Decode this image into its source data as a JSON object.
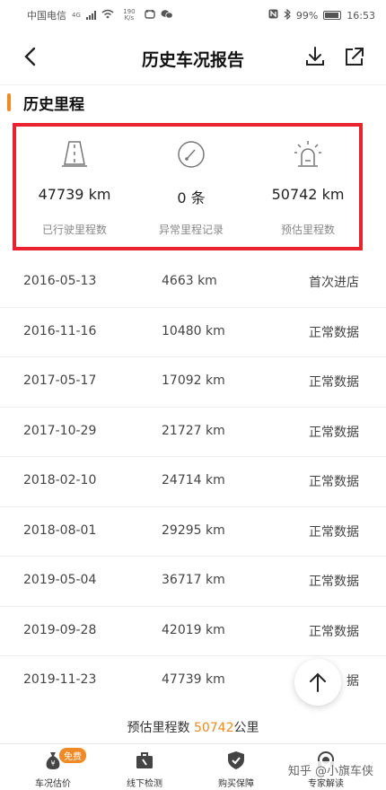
{
  "status_bar": {
    "carrier": "中国电信",
    "net": "4G",
    "speed": "190 K/s",
    "battery": "99%",
    "time": "16:53"
  },
  "header": {
    "title": "历史车况报告"
  },
  "section": {
    "title": "历史里程"
  },
  "summary": {
    "driven": {
      "value": "47739 km",
      "label": "已行驶里程数"
    },
    "abnormal": {
      "value": "0 条",
      "label": "异常里程记录"
    },
    "estimated": {
      "value": "50742 km",
      "label": "预估里程数"
    }
  },
  "records": [
    {
      "date": "2016-05-13",
      "km": "4663 km",
      "status": "首次进店"
    },
    {
      "date": "2016-11-16",
      "km": "10480 km",
      "status": "正常数据"
    },
    {
      "date": "2017-05-17",
      "km": "17092 km",
      "status": "正常数据"
    },
    {
      "date": "2017-10-29",
      "km": "21727 km",
      "status": "正常数据"
    },
    {
      "date": "2018-02-10",
      "km": "24714 km",
      "status": "正常数据"
    },
    {
      "date": "2018-08-01",
      "km": "29295 km",
      "status": "正常数据"
    },
    {
      "date": "2019-05-04",
      "km": "36717 km",
      "status": "正常数据"
    },
    {
      "date": "2019-09-28",
      "km": "42019 km",
      "status": "正常数据"
    },
    {
      "date": "2019-11-23",
      "km": "47739 km",
      "status": "据"
    }
  ],
  "footer": {
    "prefix": "预估里程数 ",
    "highlight": "50742",
    "suffix": "公里"
  },
  "bottom_nav": [
    {
      "label": "车况估价",
      "badge": "免费",
      "icon": "money-bag-icon"
    },
    {
      "label": "线下检测",
      "icon": "toolbox-icon"
    },
    {
      "label": "购买保障",
      "icon": "shield-check-icon"
    },
    {
      "label": "专家解读",
      "icon": "headset-icon"
    }
  ],
  "watermark": "知乎 @小旗车侠",
  "colors": {
    "accent": "#f08a24",
    "highlight_box": "#e8232e"
  }
}
